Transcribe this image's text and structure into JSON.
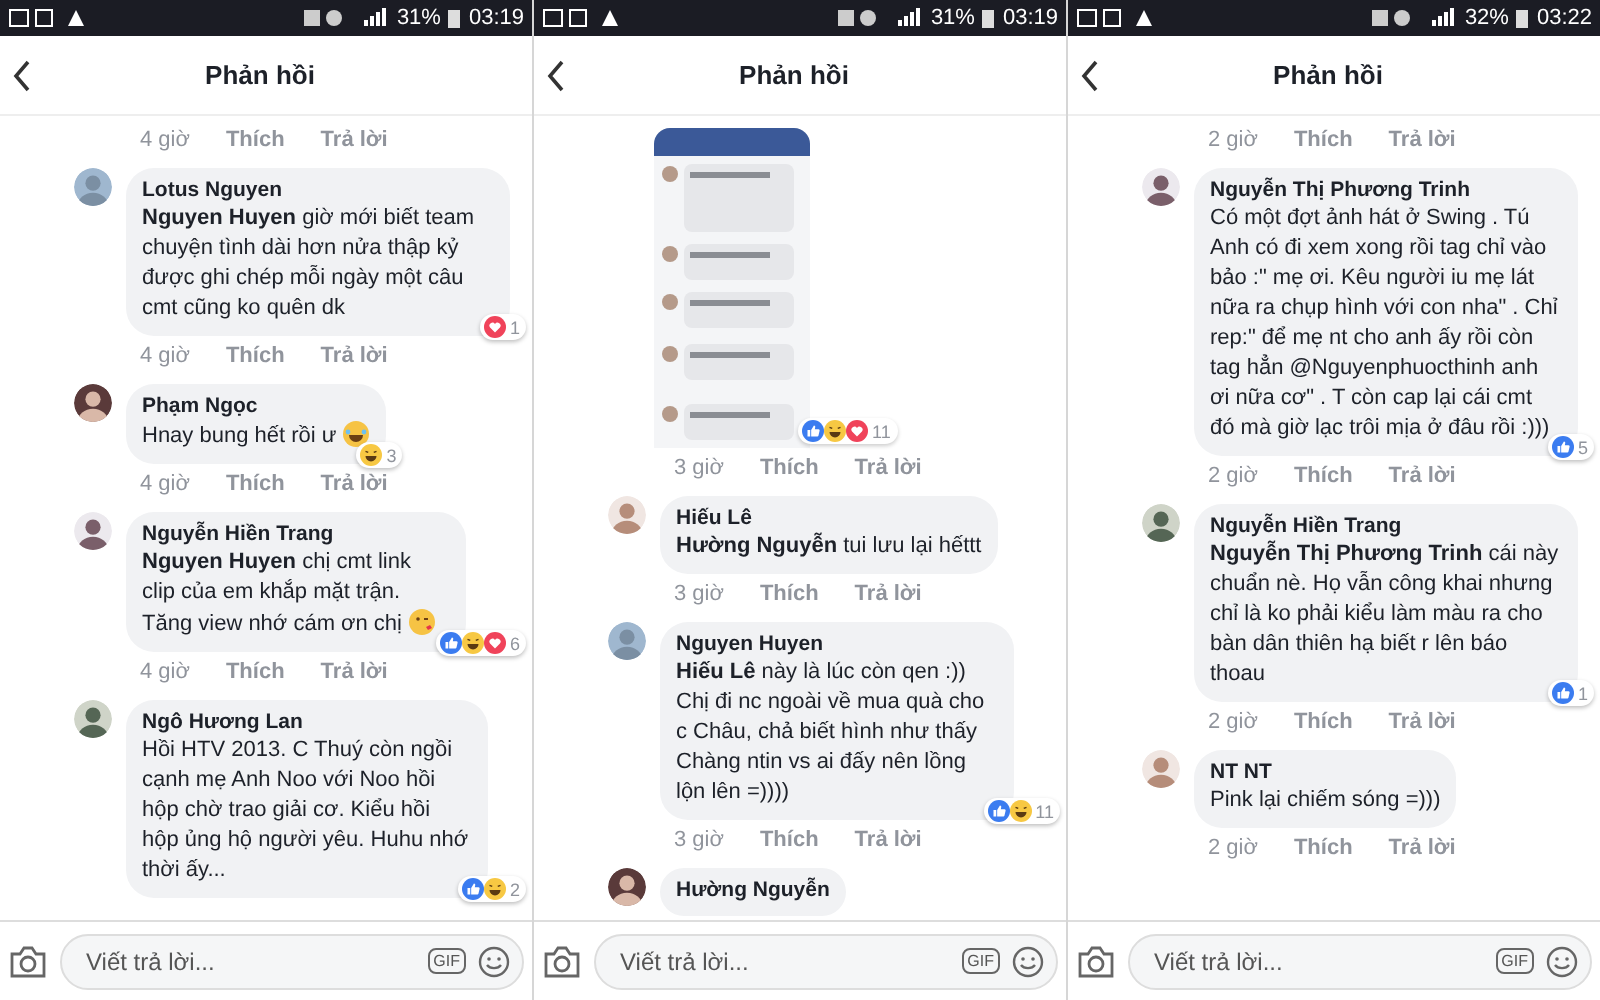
{
  "panels": [
    {
      "status": {
        "battery": "31%",
        "time": "03:19"
      },
      "title": "Phản hồi",
      "items": [
        {
          "kind": "actions",
          "time": "4 giờ",
          "like": "Thích",
          "reply": "Trả lời"
        },
        {
          "kind": "comment",
          "author": "Lotus Nguyen",
          "text": "**Nguyen Huyen** giờ mới biết team chuyện tình dài hơn nửa thập kỷ được ghi chép mỗi ngày một câu cmt cũng ko quên dk",
          "time": "4 giờ",
          "like": "Thích",
          "reply": "Trả lời",
          "reactions": {
            "love": true,
            "count": "1"
          }
        },
        {
          "kind": "comment",
          "author": "Phạm Ngọc",
          "text": "Hnay bung hết rồi ư",
          "emoji": {
            "laughing": true
          },
          "time": "4 giờ",
          "like": "Thích",
          "reply": "Trả lời",
          "reactions": {
            "haha": true,
            "count": "3"
          }
        },
        {
          "kind": "comment",
          "author": "Nguyễn Hiền Trang",
          "text": "**Nguyen Huyen** chị cmt link clip của em khắp mặt trận. Tăng view nhớ cám ơn chị",
          "emoji": {
            "kissing": true
          },
          "time": "4 giờ",
          "like": "Thích",
          "reply": "Trả lời",
          "reactions": {
            "like": true,
            "haha": true,
            "love": true,
            "count": "6"
          }
        },
        {
          "kind": "comment",
          "author": "Ngô Hương Lan",
          "text": "Hồi HTV 2013. C Thuý còn ngồi cạnh mẹ Anh Noo với Noo hồi hộp chờ trao giải cơ. Kiểu hồi hộp ủng hộ người yêu. Huhu nhớ thời ấy...",
          "reactions": {
            "like": true,
            "haha": true,
            "count": "2"
          }
        }
      ],
      "composer": {
        "placeholder": "Viết trả lời...",
        "gif": "GIF"
      }
    },
    {
      "status": {
        "battery": "31%",
        "time": "03:19"
      },
      "title": "Phản hồi",
      "items": [
        {
          "kind": "picture",
          "time": "3 giờ",
          "like": "Thích",
          "reply": "Trả lời",
          "reactions": {
            "like": true,
            "haha": true,
            "love": true,
            "count": "11"
          }
        },
        {
          "kind": "comment",
          "author": "Hiếu Lê",
          "text": "**Hường Nguyễn** tui lưu lại hếttt",
          "time": "3 giờ",
          "like": "Thích",
          "reply": "Trả lời"
        },
        {
          "kind": "comment",
          "author": "Nguyen Huyen",
          "text": "**Hiếu Lê** này là lúc còn qen :)) Chị đi nc ngoài về mua quà cho c Châu, chả biết hình như thấy Chàng ntin vs ai đấy nên lồng lộn lên =))))",
          "time": "3 giờ",
          "like": "Thích",
          "reply": "Trả lời",
          "reactions": {
            "like": true,
            "haha": true,
            "count": "11"
          }
        },
        {
          "kind": "comment",
          "author": "Hường Nguyễn"
        }
      ],
      "composer": {
        "placeholder": "Viết trả lời...",
        "gif": "GIF"
      }
    },
    {
      "status": {
        "battery": "32%",
        "time": "03:22"
      },
      "title": "Phản hồi",
      "items": [
        {
          "kind": "actions",
          "time": "2 giờ",
          "like": "Thích",
          "reply": "Trả lời"
        },
        {
          "kind": "comment",
          "author": "Nguyễn Thị Phương Trinh",
          "text": "Có một đợt ảnh hát ở Swing . Tú Anh có đi xem xong rồi tag chỉ vào bảo :\" mẹ ơi. Kêu người iu mẹ lát nữa ra chụp hình với con nha\" . Chỉ rep:\" để mẹ nt cho anh ấy rồi còn tag hẳn @Nguyenphuocthinh anh ơi nữa cơ\" . T còn cap lại cái cmt đó mà giờ lạc trôi mịa ở đâu rồi :)))",
          "time": "2 giờ",
          "like": "Thích",
          "reply": "Trả lời",
          "reactions": {
            "like": true,
            "count": "5"
          }
        },
        {
          "kind": "comment",
          "author": "Nguyễn Hiền Trang",
          "text": "**Nguyễn Thị Phương Trinh** cái này chuẩn nè. Họ vẫn công khai nhưng chỉ là ko phải kiểu làm màu ra cho bàn dân thiên hạ biết r lên báo thoau",
          "time": "2 giờ",
          "like": "Thích",
          "reply": "Trả lời",
          "reactions": {
            "like": true,
            "count": "1"
          }
        },
        {
          "kind": "comment",
          "author": "NT NT",
          "text": "Pink lại chiếm sóng =)))",
          "time": "2 giờ",
          "like": "Thích",
          "reply": "Trả lời"
        }
      ],
      "composer": {
        "placeholder": "Viết trả lời...",
        "gif": "GIF"
      }
    }
  ]
}
